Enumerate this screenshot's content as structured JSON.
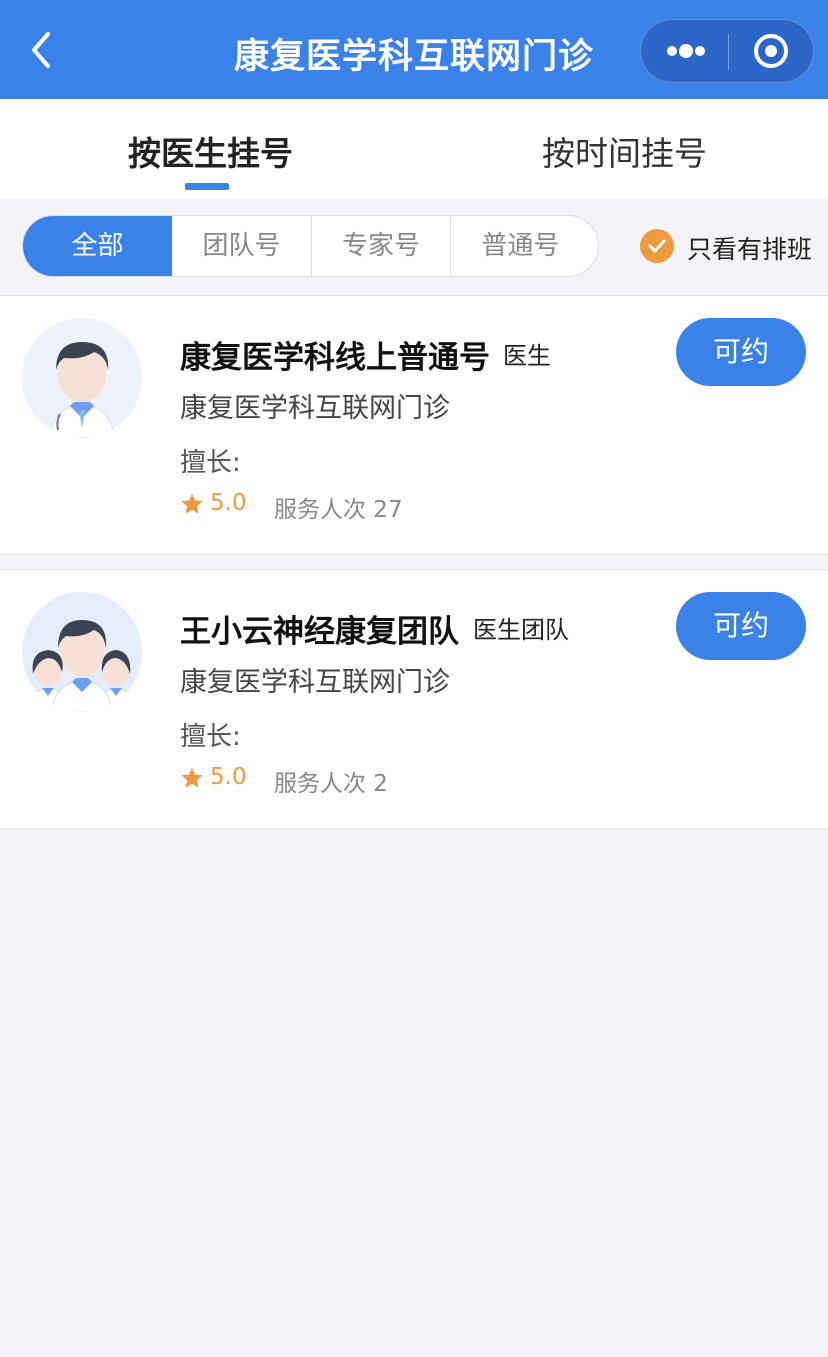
{
  "header": {
    "title": "康复医学科互联网门诊",
    "back_icon": "chevron-left-icon",
    "more_icon": "more-dots-icon",
    "close_icon": "target-close-icon",
    "bg_color": "#3b82e8"
  },
  "tabs": [
    {
      "label": "按医生挂号",
      "active": true
    },
    {
      "label": "按时间挂号",
      "active": false
    }
  ],
  "filters": {
    "segments": [
      {
        "label": "全部",
        "active": true
      },
      {
        "label": "团队号",
        "active": false
      },
      {
        "label": "专家号",
        "active": false
      },
      {
        "label": "普通号",
        "active": false
      }
    ],
    "only_scheduled": {
      "label": "只看有排班",
      "checked": true,
      "color": "#ee9a3e"
    }
  },
  "doctors": [
    {
      "name": "康复医学科线上普通号",
      "tag": "医生",
      "department": "康复医学科互联网门诊",
      "skill_label": "擅长:",
      "rating": "5.0",
      "served": "服务人次 27",
      "button": "可约",
      "avatar": "doctor-avatar"
    },
    {
      "name": "王小云神经康复团队",
      "tag": "医生团队",
      "department": "康复医学科互联网门诊",
      "skill_label": "擅长:",
      "rating": "5.0",
      "served": "服务人次 2",
      "button": "可约",
      "avatar": "team-avatar"
    }
  ]
}
